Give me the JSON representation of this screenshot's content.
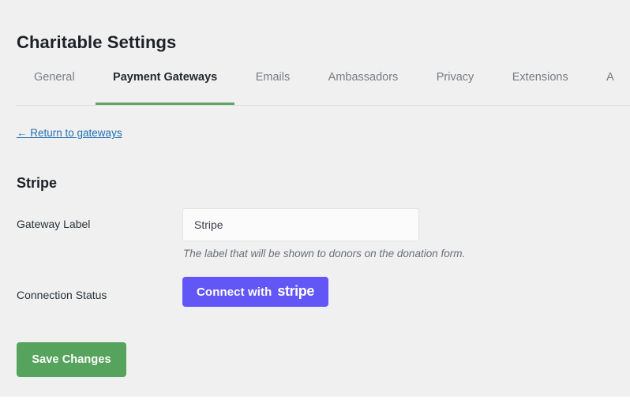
{
  "page": {
    "title": "Charitable Settings"
  },
  "tabs": [
    {
      "label": "General",
      "active": false
    },
    {
      "label": "Payment Gateways",
      "active": true
    },
    {
      "label": "Emails",
      "active": false
    },
    {
      "label": "Ambassadors",
      "active": false
    },
    {
      "label": "Privacy",
      "active": false
    },
    {
      "label": "Extensions",
      "active": false
    },
    {
      "label": "A",
      "active": false
    }
  ],
  "breadcrumb": {
    "return_link": "← Return to gateways"
  },
  "section": {
    "title": "Stripe"
  },
  "fields": {
    "gateway_label": {
      "label": "Gateway Label",
      "value": "Stripe",
      "placeholder": "",
      "help": "The label that will be shown to donors on the donation form."
    },
    "connection_status": {
      "label": "Connection Status",
      "button_prefix": "Connect with",
      "button_brand": "stripe"
    }
  },
  "actions": {
    "save_label": "Save Changes"
  },
  "colors": {
    "page_background": "#f0f0f1",
    "accent_green": "#5fa464",
    "save_green": "#55a35c",
    "stripe_indigo": "#6356f6",
    "link_blue": "#2271b1",
    "text_dark": "#1d2127",
    "text_muted": "#787c82"
  }
}
